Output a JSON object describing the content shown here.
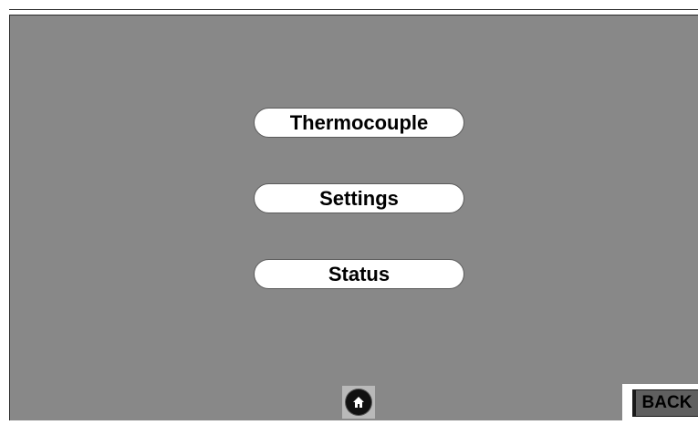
{
  "menu": {
    "items": [
      {
        "label": "Thermocouple"
      },
      {
        "label": "Settings"
      },
      {
        "label": "Status"
      }
    ]
  },
  "footer": {
    "home_icon": "home-icon",
    "back_label": "BACK"
  },
  "colors": {
    "screen_background": "#888888",
    "button_background": "#ffffff",
    "back_button_background": "#5f5f5f"
  }
}
